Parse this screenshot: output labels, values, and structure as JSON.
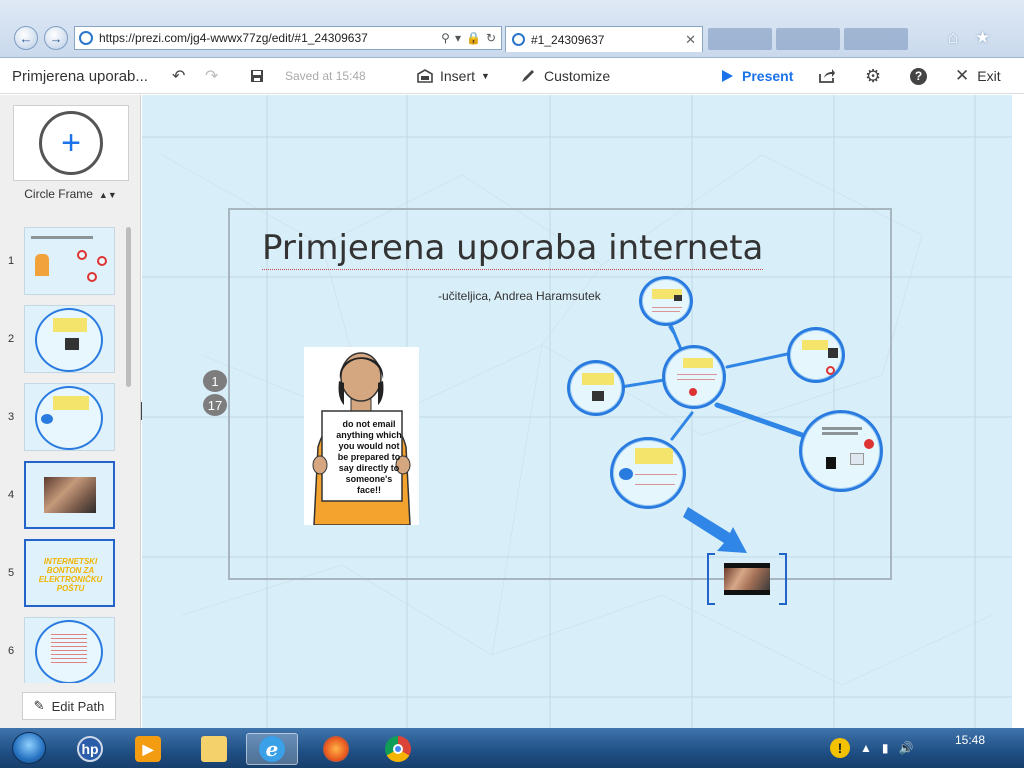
{
  "browser": {
    "url": "https://prezi.com/jg4-wwwx77zg/edit/#1_24309637",
    "tab_title": "#1_24309637",
    "back_icon": "back-arrow-icon",
    "forward_icon": "forward-arrow-icon"
  },
  "toolbar": {
    "title": "Primjerena uporab...",
    "saved": "Saved at 15:48",
    "insert": "Insert",
    "customize": "Customize",
    "present": "Present",
    "exit": "Exit"
  },
  "sidebar": {
    "frame_type": "Circle Frame",
    "edit_path": "Edit Path",
    "thumbnails": [
      {
        "number": "1"
      },
      {
        "number": "2"
      },
      {
        "number": "3"
      },
      {
        "number": "4"
      },
      {
        "number": "5",
        "text": "INTERNETSKI BONTON ZA ELEKTRONIČKU POŠTU"
      },
      {
        "number": "6"
      }
    ]
  },
  "canvas": {
    "title": "Primjerena uporaba interneta",
    "subtitle": "-učiteljica, Andrea Haramsutek",
    "step_badges": [
      "1",
      "17"
    ],
    "sign_text": "do not email anything which you would not be prepared to say directly to someone's face!!"
  },
  "taskbar": {
    "clock": "15:48"
  },
  "colors": {
    "accent": "#1a73e8",
    "canvas_bg": "#d8eef8",
    "circle_border": "#2a7be0",
    "path_arrow": "#2f86e6"
  }
}
